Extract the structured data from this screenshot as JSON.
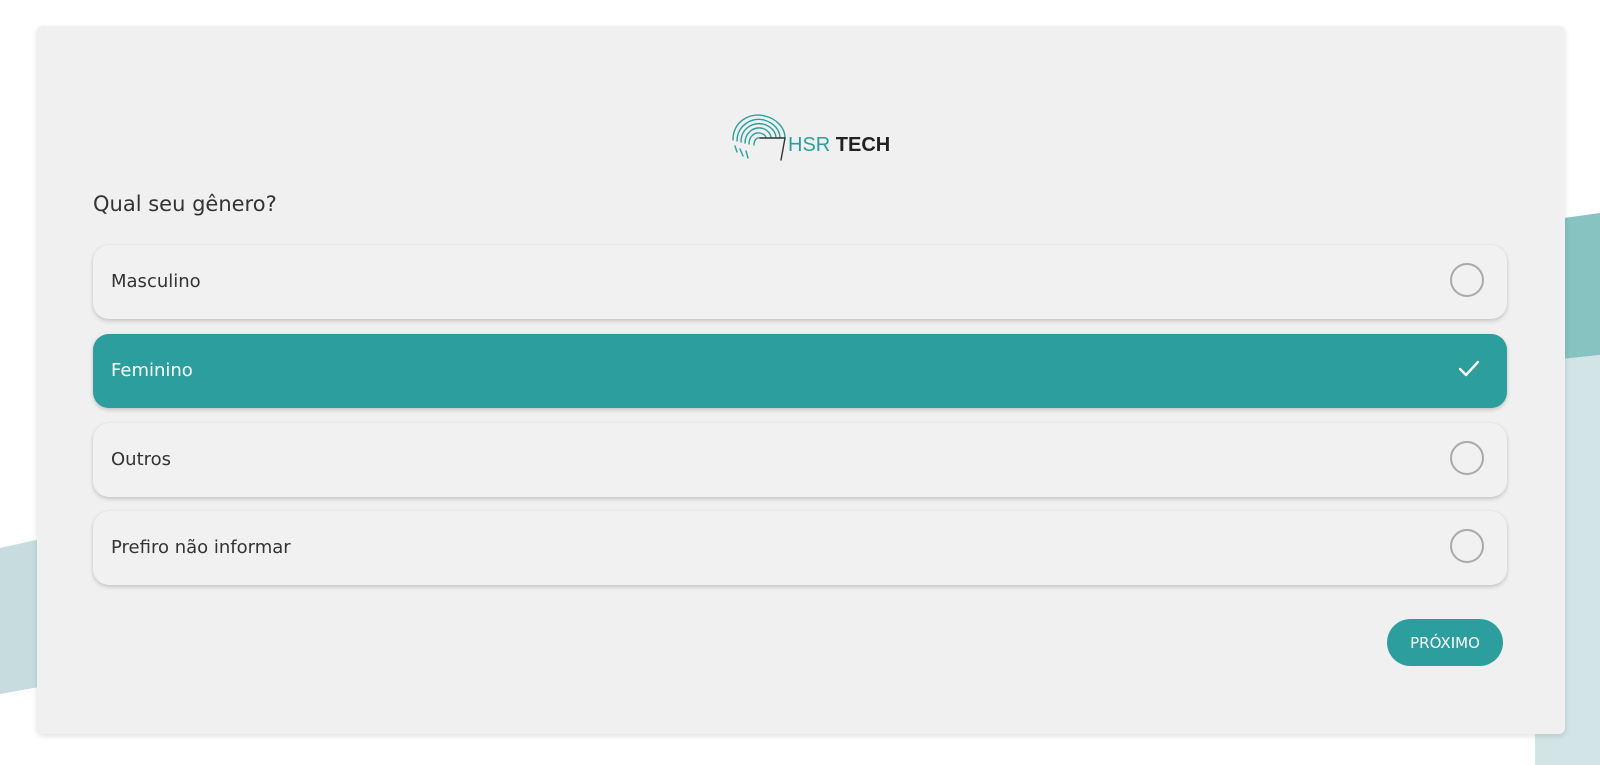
{
  "brand": {
    "name_part1": "HSR",
    "name_part2": "TECH",
    "logo_icon": "fingerprint-wave-icon"
  },
  "question": {
    "text": "Qual seu gênero?"
  },
  "options": [
    {
      "label": "Masculino",
      "selected": false
    },
    {
      "label": "Feminino",
      "selected": true
    },
    {
      "label": "Outros",
      "selected": false
    },
    {
      "label": "Prefiro não informar",
      "selected": false
    }
  ],
  "actions": {
    "next_label": "PRÓXIMO"
  },
  "colors": {
    "accent": "#2b9e9d",
    "card_bg": "#f0f0f0",
    "option_bg": "#f1f1f1",
    "radio_border": "#a9a9a9"
  },
  "icons": {
    "unselected": "radio-empty-icon",
    "selected": "checkmark-icon"
  }
}
